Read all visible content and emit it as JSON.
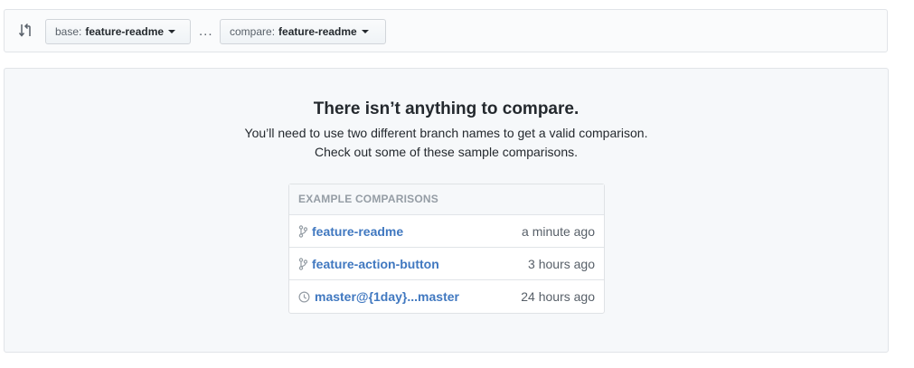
{
  "range": {
    "base_label": "base:",
    "base_value": "feature-readme",
    "ellipsis": "...",
    "compare_label": "compare:",
    "compare_value": "feature-readme"
  },
  "blankslate": {
    "title": "There isn’t anything to compare.",
    "line1": "You’ll need to use two different branch names to get a valid comparison.",
    "line2": "Check out some of these sample comparisons."
  },
  "examples": {
    "header": "EXAMPLE COMPARISONS",
    "items": [
      {
        "icon": "git-branch-icon",
        "label": "feature-readme",
        "time": "a minute ago"
      },
      {
        "icon": "git-branch-icon",
        "label": "feature-action-button",
        "time": "3 hours ago"
      },
      {
        "icon": "history-icon",
        "label": "master@{1day}...master",
        "time": "24 hours ago"
      }
    ]
  },
  "colors": {
    "link": "#4078c0",
    "panel_bg": "#f6f8fa",
    "border": "#e1e4e8"
  }
}
